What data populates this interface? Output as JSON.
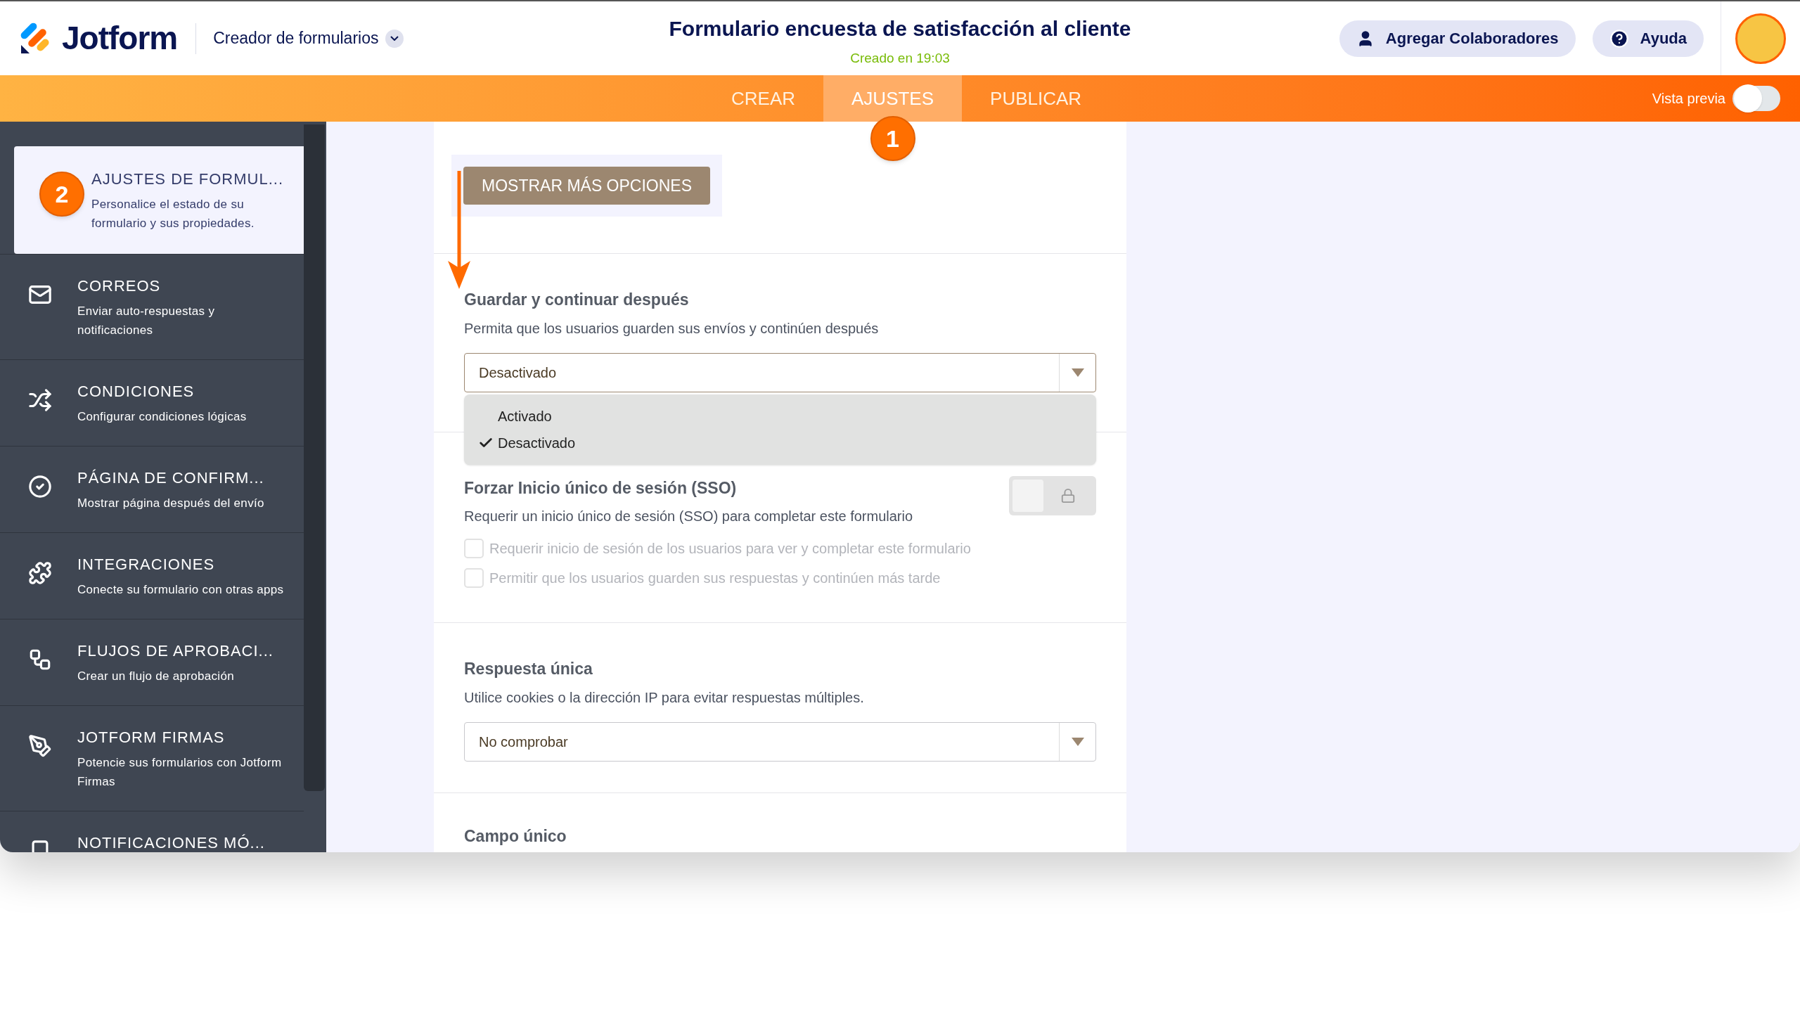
{
  "header": {
    "logo": "Jotform",
    "builder_menu": "Creador de formularios",
    "title": "Formulario encuesta de satisfacción al cliente",
    "subtitle": "Creado en 19:03",
    "buttons": [
      {
        "label": "Agregar Colaboradores",
        "kind": "collaborators"
      },
      {
        "label": "Ayuda",
        "kind": "help"
      }
    ]
  },
  "tabs": [
    {
      "label": "CREAR",
      "selected": false
    },
    {
      "label": "AJUSTES",
      "selected": true,
      "annotation": "1"
    },
    {
      "label": "PUBLICAR",
      "selected": false
    }
  ],
  "preview": {
    "label": "Vista previa",
    "on": false
  },
  "sidebar": {
    "items": [
      {
        "title": "AJUSTES DE FORMUL...",
        "description": "Personalice el estado de su formulario y sus propiedades.",
        "selected": true,
        "annotation": "2"
      },
      {
        "kind": "mail",
        "title": "CORREOS",
        "description": "Enviar auto-respuestas y notificaciones",
        "selected": false
      },
      {
        "kind": "shuffle",
        "title": "CONDICIONES",
        "description": "Configurar condiciones lógicas",
        "selected": false
      },
      {
        "kind": "check",
        "title": "PÁGINA DE CONFIRM...",
        "description": "Mostrar página después del envío",
        "selected": false
      },
      {
        "kind": "puzzle",
        "title": "INTEGRACIONES",
        "description": "Conecte su formulario con otras apps",
        "selected": false
      },
      {
        "kind": "flow",
        "title": "FLUJOS DE APROBACI...",
        "description": "Crear un flujo de aprobación",
        "selected": false
      },
      {
        "kind": "pen",
        "title": "JOTFORM FIRMAS",
        "description": "Potencie sus formularios con Jotform Firmas",
        "selected": false
      },
      {
        "kind": "mobile",
        "title": "NOTIFICACIONES MÓ...",
        "selected": false
      }
    ]
  },
  "form": {
    "more_options_button": "MOSTRAR MÁS OPCIONES",
    "sections": [
      {
        "kind": "dropdown",
        "title": "Guardar y continuar después",
        "description": "Permita que los usuarios guarden sus envíos y continúen después",
        "value": "Desactivado",
        "expanded": true,
        "options": [
          {
            "label": "Activado",
            "selected": false
          },
          {
            "label": "Desactivado",
            "selected": true
          }
        ]
      },
      {
        "kind": "toggle",
        "title": "Forzar Inicio único de sesión (SSO)",
        "description": "Requerir un inicio único de sesión (SSO) para completar este formulario",
        "on": false,
        "locked": true,
        "checkboxes": [
          {
            "label": "Requerir inicio de sesión de los usuarios para ver y completar este formulario",
            "checked": false,
            "disabled": true
          },
          {
            "label": "Permitir que los usuarios guarden sus respuestas y continúen más tarde",
            "checked": false,
            "disabled": true
          }
        ]
      },
      {
        "kind": "dropdown",
        "title": "Respuesta única",
        "description": "Utilice cookies o la dirección IP para evitar respuestas múltiples.",
        "value": "No comprobar",
        "expanded": false
      },
      {
        "kind": "heading",
        "title": "Campo único"
      }
    ]
  }
}
